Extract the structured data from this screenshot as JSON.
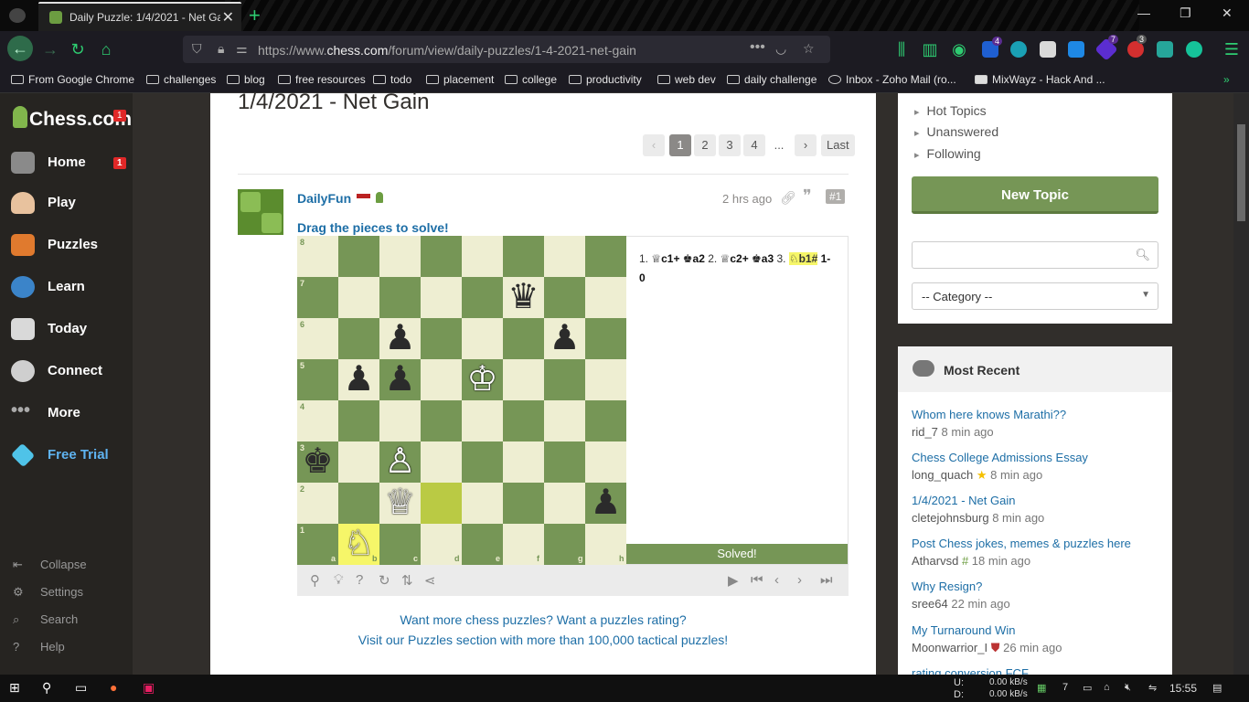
{
  "browser": {
    "tab_title": "Daily Puzzle: 1/4/2021 - Net Gai",
    "url_prefix": "https://www.",
    "url_domain": "chess.com",
    "url_path": "/forum/view/daily-puzzles/1-4-2021-net-gain",
    "ext_badges": [
      "4",
      "7",
      "3"
    ]
  },
  "bookmarks": [
    "From Google Chrome",
    "challenges",
    "blog",
    "free resources",
    "todo",
    "placement",
    "college",
    "productivity",
    "web dev",
    "daily challenge",
    "Inbox - Zoho Mail (ro...",
    "MixWayz - Hack And ..."
  ],
  "sidebar": {
    "logo": "Chess.com",
    "logo_badge": "1",
    "items": [
      {
        "label": "Home",
        "badge": "1"
      },
      {
        "label": "Play"
      },
      {
        "label": "Puzzles"
      },
      {
        "label": "Learn"
      },
      {
        "label": "Today"
      },
      {
        "label": "Connect"
      },
      {
        "label": "More"
      },
      {
        "label": "Free Trial"
      }
    ],
    "bottom": [
      "Collapse",
      "Settings",
      "Search",
      "Help"
    ]
  },
  "main": {
    "title": "1/4/2021 - Net Gain",
    "pagination": [
      "1",
      "2",
      "3",
      "4",
      "...",
      "Last"
    ],
    "post": {
      "author": "DailyFun",
      "time": "2 hrs ago",
      "number": "#1",
      "instruction": "Drag the pieces to solve!",
      "moves_text": [
        {
          "t": "1. ",
          "bold": false
        },
        {
          "t": "♕c1+ ",
          "bold": true
        },
        {
          "t": "♚a2 ",
          "bold": true
        },
        {
          "t": "2. ",
          "bold": false
        },
        {
          "t": "♕c2+ ",
          "bold": true
        },
        {
          "t": "♚a3 ",
          "bold": true
        },
        {
          "t": "3. ",
          "bold": false
        }
      ],
      "final_move": "♘b1#",
      "result": "1-0",
      "status": "Solved!"
    },
    "promo_line1": "Want more chess puzzles? Want a puzzles rating?",
    "promo_line2": "Visit our Puzzles section with more than 100,000 tactical puzzles!"
  },
  "board": {
    "files": [
      "a",
      "b",
      "c",
      "d",
      "e",
      "f",
      "g",
      "h"
    ],
    "ranks": [
      "8",
      "7",
      "6",
      "5",
      "4",
      "3",
      "2",
      "1"
    ],
    "pieces": [
      {
        "sq": "f7",
        "glyph": "♛",
        "side": "b"
      },
      {
        "sq": "c6",
        "glyph": "♟",
        "side": "b"
      },
      {
        "sq": "g6",
        "glyph": "♟",
        "side": "b"
      },
      {
        "sq": "b5",
        "glyph": "♟",
        "side": "b"
      },
      {
        "sq": "c5",
        "glyph": "♟",
        "side": "b"
      },
      {
        "sq": "e5",
        "glyph": "♔",
        "side": "w"
      },
      {
        "sq": "a3",
        "glyph": "♚",
        "side": "b"
      },
      {
        "sq": "c3",
        "glyph": "♙",
        "side": "w"
      },
      {
        "sq": "c2",
        "glyph": "♕",
        "side": "w"
      },
      {
        "sq": "h2",
        "glyph": "♟",
        "side": "b"
      },
      {
        "sq": "b1",
        "glyph": "♘",
        "side": "w"
      }
    ],
    "highlight_from": "d2",
    "highlight_to": "b1"
  },
  "right": {
    "filters": [
      "Hot Topics",
      "Unanswered",
      "Following"
    ],
    "new_topic": "New Topic",
    "search_placeholder": "",
    "category": "-- Category --",
    "recent_title": "Most Recent",
    "recent": [
      {
        "title": "Whom here knows Marathi??",
        "author": "rid_7",
        "time": "8 min ago"
      },
      {
        "title": "Chess College Admissions Essay",
        "author": "long_quach",
        "time": "8 min ago"
      },
      {
        "title": "1/4/2021 - Net Gain",
        "author": "cletejohnsburg",
        "time": "8 min ago"
      },
      {
        "title": "Post Chess jokes, memes & puzzles here",
        "author": "Atharvsd",
        "time": "18 min ago"
      },
      {
        "title": "Why Resign?",
        "author": "sree64",
        "time": "22 min ago"
      },
      {
        "title": "My Turnaround Win",
        "author": "Moonwarrior_I",
        "time": "26 min ago"
      },
      {
        "title": "rating conversion FCF",
        "author": "",
        "time": ""
      }
    ]
  },
  "taskbar": {
    "net_up": "U:",
    "net_down": "D:",
    "up_rate": "0.00 kB/s",
    "down_rate": "0.00 kB/s",
    "tray_num": "7",
    "clock": "15:55"
  },
  "colors": {
    "accent_green": "#769656",
    "light_square": "#eeeed2",
    "dark_square": "#769656",
    "link_blue": "#1d6ea6"
  }
}
